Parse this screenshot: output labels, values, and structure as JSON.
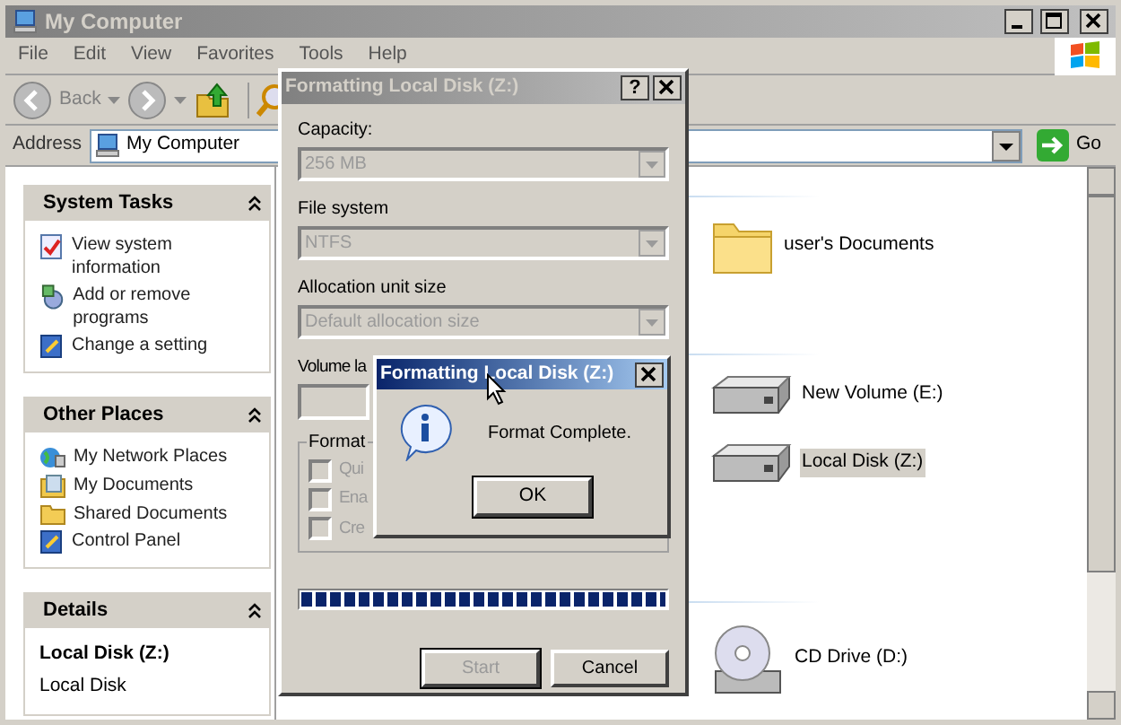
{
  "window": {
    "title": "My Computer",
    "active": false
  },
  "menu": [
    "File",
    "Edit",
    "View",
    "Favorites",
    "Tools",
    "Help"
  ],
  "toolbar": {
    "back": "Back"
  },
  "address": {
    "label": "Address",
    "value": "My Computer",
    "go": "Go"
  },
  "task_panes": [
    {
      "title": "System Tasks",
      "expanded": true,
      "items": [
        "View system information",
        "Add or remove programs",
        "Change a setting"
      ]
    },
    {
      "title": "Other Places",
      "expanded": true,
      "items": [
        "My Network Places",
        "My Documents",
        "Shared Documents",
        "Control Panel"
      ]
    },
    {
      "title": "Details",
      "expanded": true,
      "details": {
        "name": "Local Disk (Z:)",
        "type": "Local Disk"
      }
    }
  ],
  "groups": [
    {
      "items": [
        {
          "label": "user's Documents",
          "kind": "folder",
          "selected": false
        }
      ]
    },
    {
      "items": [
        {
          "label": "New Volume (E:)",
          "kind": "disk",
          "selected": false
        },
        {
          "label": "Local Disk (Z:)",
          "kind": "disk",
          "selected": true
        }
      ]
    },
    {
      "items": [
        {
          "label": "CD Drive (D:)",
          "kind": "cd",
          "selected": false
        }
      ]
    }
  ],
  "format_dialog": {
    "title": "Formatting Local Disk (Z:)",
    "active": false,
    "help": "?",
    "fields": [
      {
        "label": "Capacity:",
        "value": "256 MB",
        "disabled": true
      },
      {
        "label": "File system",
        "value": "NTFS",
        "disabled": true
      },
      {
        "label": "Allocation unit size",
        "value": "Default allocation size",
        "disabled": true
      }
    ],
    "volume_label": "Volume la",
    "options_group": "Format",
    "options": [
      {
        "label": "Qui",
        "checked": false,
        "disabled": true
      },
      {
        "label": "Ena",
        "checked": false,
        "disabled": true
      },
      {
        "label": "Cre",
        "checked": false,
        "disabled": true
      }
    ],
    "progress": {
      "level": 1
    },
    "buttons": [
      {
        "label": "Start",
        "disabled": true
      },
      {
        "label": "Cancel",
        "disabled": false
      }
    ]
  },
  "message_box": {
    "title": "Formatting Local Disk (Z:)",
    "active": true,
    "message": "Format Complete.",
    "button": "OK"
  }
}
